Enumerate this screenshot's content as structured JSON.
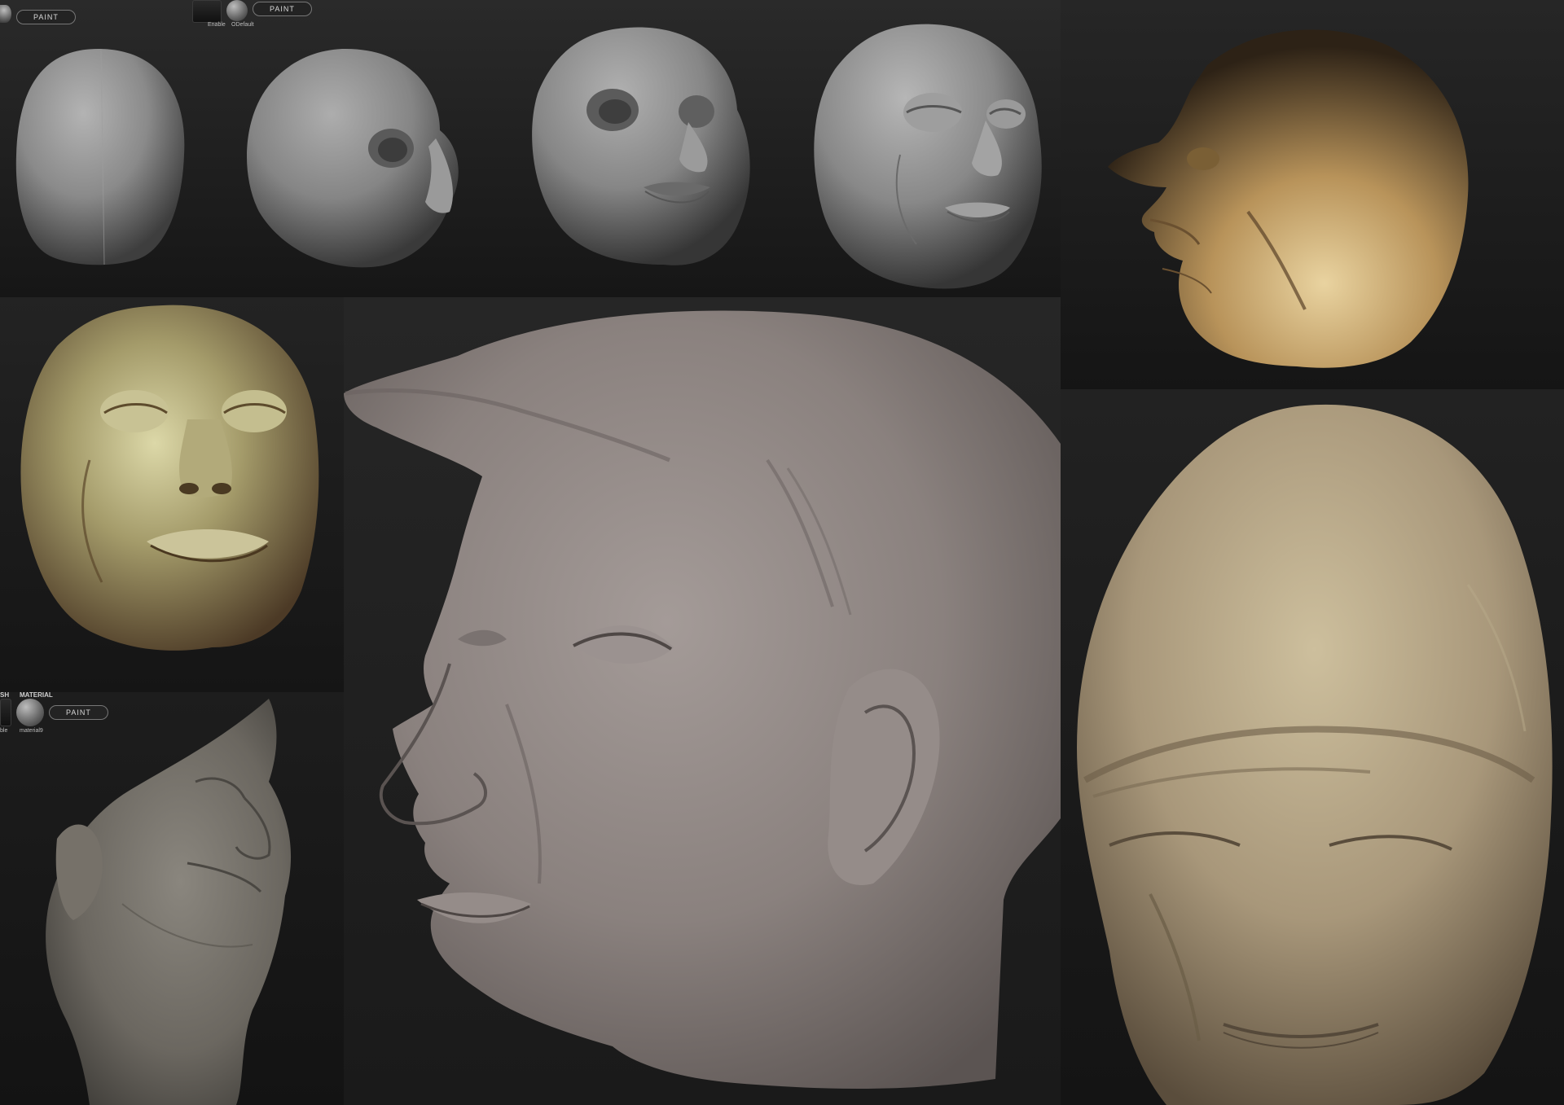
{
  "ui": {
    "paint_label": "PAINT",
    "material_header": "MATERIAL",
    "brush_header": "SH",
    "enable_label": "Enable",
    "default_label": "ODefault",
    "material_name": "material9",
    "side_label": "ble"
  },
  "colors": {
    "background": "#1a1a1a",
    "clay_gray": "#8d8d8d",
    "clay_brown": "#8a7f78",
    "gold": "#bfa36a",
    "tan": "#b6a583",
    "olive": "#a8a27b"
  }
}
